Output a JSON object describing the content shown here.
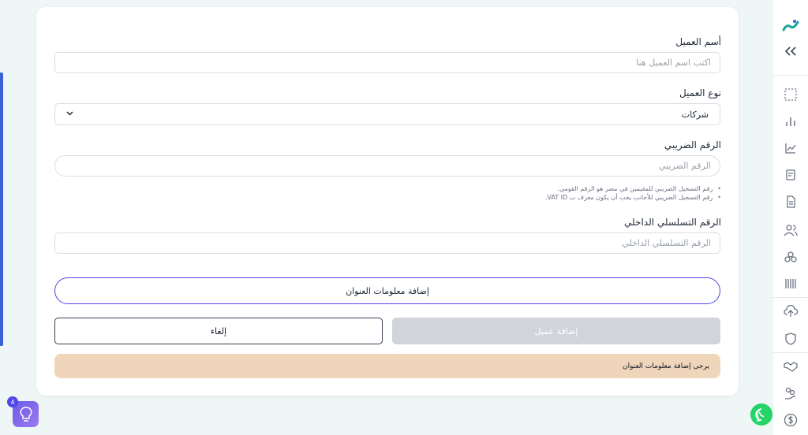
{
  "form": {
    "customer_name_label": "أسم العميل",
    "customer_name_placeholder": "اكتب اسم العميل هنا",
    "customer_type_label": "نوع العميل",
    "customer_type_value": "شركات",
    "tax_number_label": "الرقم الضريبي",
    "tax_number_placeholder": "الرقم الضريبي",
    "tax_hints": [
      "رقم التسجيل الضريبي للمقيمين في مصر هو الرقم القومي.",
      "رقم التسجيل الضريبي للأجانب يجب أن يكون معرف ب VAT ID."
    ],
    "internal_serial_label": "الرقم التسلسلي الداخلي",
    "internal_serial_placeholder": "الرقم التسلسلي الداخلي",
    "add_address_button": "إضافة معلومات العنوان",
    "add_customer_button": "إضافة عميل",
    "cancel_button": "إلغاء",
    "warning": "يرجى إضافة معلومات العنوان"
  },
  "sidebar": {
    "icons": [
      "logo-icon",
      "collapse-icon",
      "dashboard-icon",
      "bar-chart-icon",
      "line-chart-icon",
      "notes-icon",
      "invoice-icon",
      "users-icon",
      "products-icon",
      "barcode-icon",
      "upload-icon",
      "shield-icon",
      "handshake-icon",
      "hand-coins-icon",
      "dollar-icon"
    ]
  },
  "widgets": {
    "notification_count": "4"
  },
  "colors": {
    "accent": "#4f46e5",
    "warning_bg": "#efd5b9",
    "disabled_button": "#d1d5db"
  }
}
